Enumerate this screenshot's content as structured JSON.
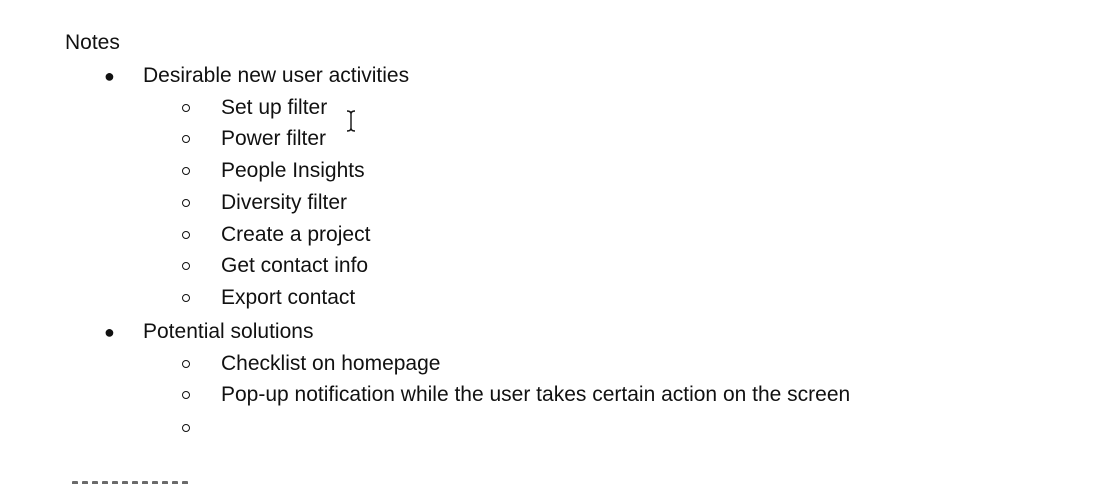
{
  "document": {
    "heading": "Notes",
    "sections": [
      {
        "label": "Desirable new user activities",
        "items": [
          "Set up filter",
          "Power filter",
          "People Insights",
          "Diversity filter",
          "Create a project",
          "Get contact info",
          "Export contact"
        ]
      },
      {
        "label": "Potential solutions",
        "items": [
          "Checklist on homepage",
          "Pop-up notification while the user takes certain action on the screen",
          ""
        ]
      }
    ]
  },
  "cursor": {
    "icon": "text-ibeam-cursor-icon"
  },
  "colors": {
    "text": "#111111",
    "background": "#ffffff"
  }
}
